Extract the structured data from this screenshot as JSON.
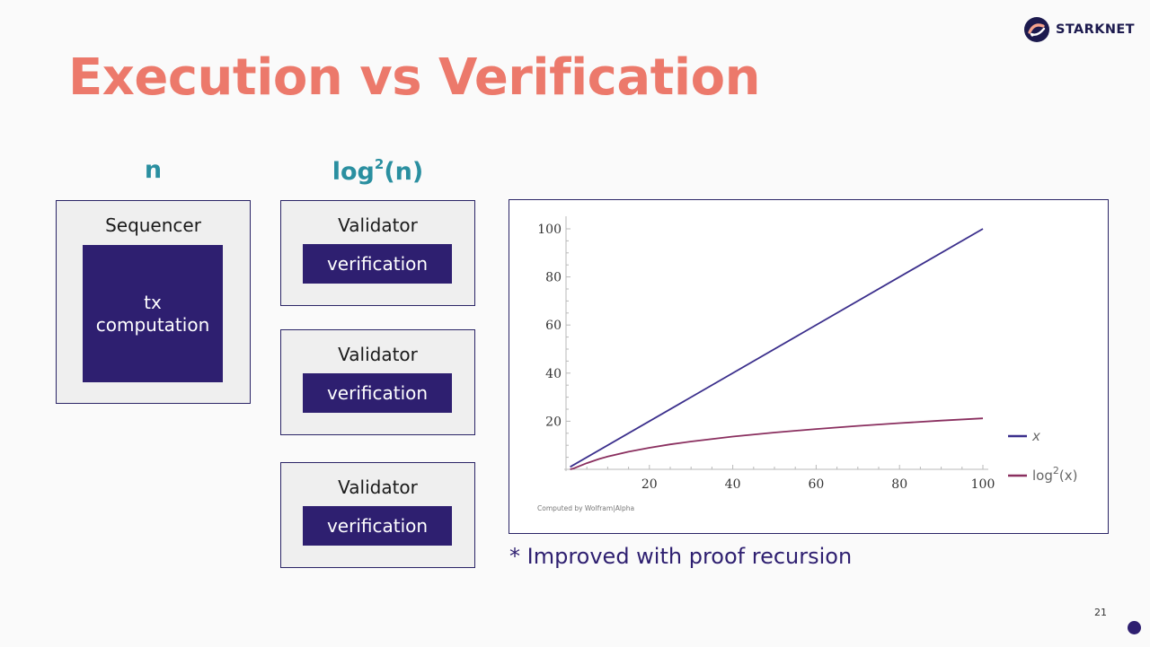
{
  "brand": {
    "name": "STARKNET"
  },
  "slide": {
    "title": "Execution vs Verification",
    "page_number": "21"
  },
  "columns": {
    "left_heading": "n",
    "right_heading_base": "log",
    "right_heading_exp": "2",
    "right_heading_arg": "(n)"
  },
  "sequencer": {
    "label": "Sequencer",
    "block_line1": "tx",
    "block_line2": "computation"
  },
  "validators": [
    {
      "label": "Validator",
      "block": "verification"
    },
    {
      "label": "Validator",
      "block": "verification"
    },
    {
      "label": "Validator",
      "block": "verification"
    }
  ],
  "footnote": "* Improved with proof recursion",
  "colors": {
    "accent_title": "#ec796b",
    "heading_teal": "#2a8fa0",
    "block_purple": "#2e1f70",
    "line_x": "#3b2f8c",
    "line_log": "#8a2f5f"
  },
  "chart_data": {
    "type": "line",
    "x_ticks": [
      20,
      40,
      60,
      80,
      100
    ],
    "y_ticks": [
      20,
      40,
      60,
      80,
      100
    ],
    "xlim": [
      0,
      100
    ],
    "ylim": [
      0,
      100
    ],
    "legend_position": "right",
    "credit": "Computed by Wolfram|Alpha",
    "series": [
      {
        "name": "x",
        "name_base": "x",
        "name_exp": "",
        "name_arg": "",
        "color": "#3b2f8c",
        "x": [
          1,
          100
        ],
        "y": [
          1,
          100
        ]
      },
      {
        "name": "log2(x)",
        "name_base": "log",
        "name_exp": "2",
        "name_arg": "(x)",
        "color": "#8a2f5f",
        "x": [
          1,
          2,
          3,
          5,
          8,
          10,
          15,
          20,
          25,
          30,
          40,
          50,
          60,
          70,
          80,
          90,
          100
        ],
        "y": [
          0,
          0.48,
          1.21,
          2.59,
          4.32,
          5.3,
          7.33,
          8.97,
          10.36,
          11.57,
          13.61,
          15.3,
          16.76,
          18.05,
          19.2,
          20.25,
          21.21
        ]
      }
    ]
  }
}
